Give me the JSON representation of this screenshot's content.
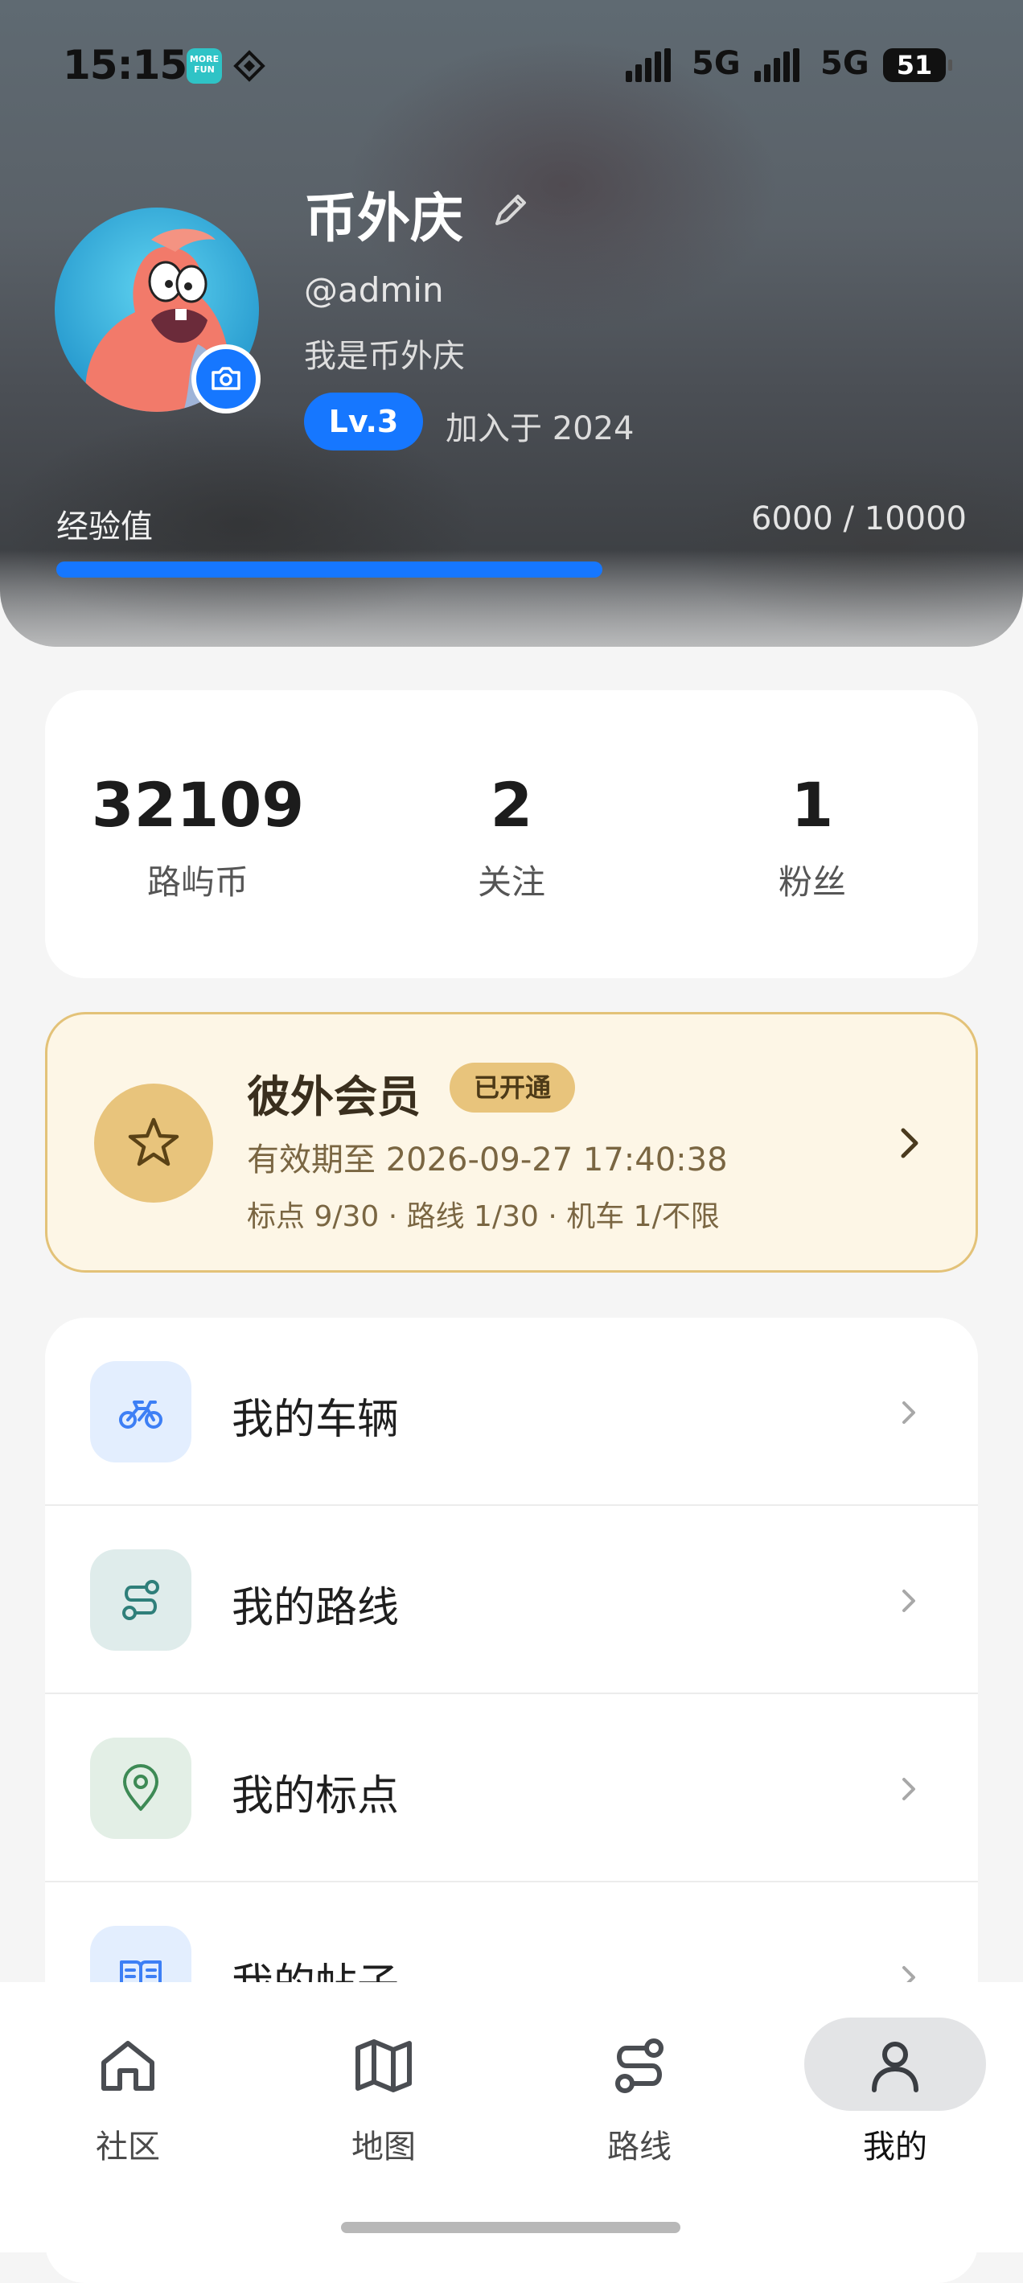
{
  "status_bar": {
    "time": "15:15",
    "app_icon_1_text": "MORE FUN",
    "network_1": "5G",
    "network_2": "5G",
    "battery": "51"
  },
  "profile": {
    "name": "币外庆",
    "handle": "@admin",
    "bio": "我是币外庆",
    "level": "Lv.3",
    "joined": "加入于 2024",
    "exp_label": "经验值",
    "exp_text": "6000 / 10000",
    "exp_progress": 0.6
  },
  "stats": [
    {
      "value": "32109",
      "label": "路屿币"
    },
    {
      "value": "2",
      "label": "关注"
    },
    {
      "value": "1",
      "label": "粉丝"
    }
  ],
  "vip": {
    "title": "彼外会员",
    "badge": "已开通",
    "expiry": "有效期至 2026-09-27 17:40:38",
    "quota": "标点 9/30 · 路线 1/30 · 机车 1/不限"
  },
  "menu": [
    {
      "label": "我的车辆",
      "icon": "motorcycle-icon",
      "icon_color": "#3d7ff5",
      "icon_bg": "#e3eefe"
    },
    {
      "label": "我的路线",
      "icon": "route-icon",
      "icon_color": "#2f7f7a",
      "icon_bg": "#dfeceb"
    },
    {
      "label": "我的标点",
      "icon": "location-pin-icon",
      "icon_color": "#3d8a55",
      "icon_bg": "#e3efe6"
    },
    {
      "label": "我的帖子",
      "icon": "book-icon",
      "icon_color": "#3d7ff5",
      "icon_bg": "#e3eefe"
    }
  ],
  "nav": [
    {
      "label": "社区",
      "icon": "home-icon",
      "active": false
    },
    {
      "label": "地图",
      "icon": "map-icon",
      "active": false
    },
    {
      "label": "路线",
      "icon": "route-icon",
      "active": false
    },
    {
      "label": "我的",
      "icon": "person-icon",
      "active": true
    }
  ],
  "colors": {
    "accent": "#1677ff",
    "vip_gold": "#e8c47c",
    "vip_bg": "#fdf6e6"
  }
}
